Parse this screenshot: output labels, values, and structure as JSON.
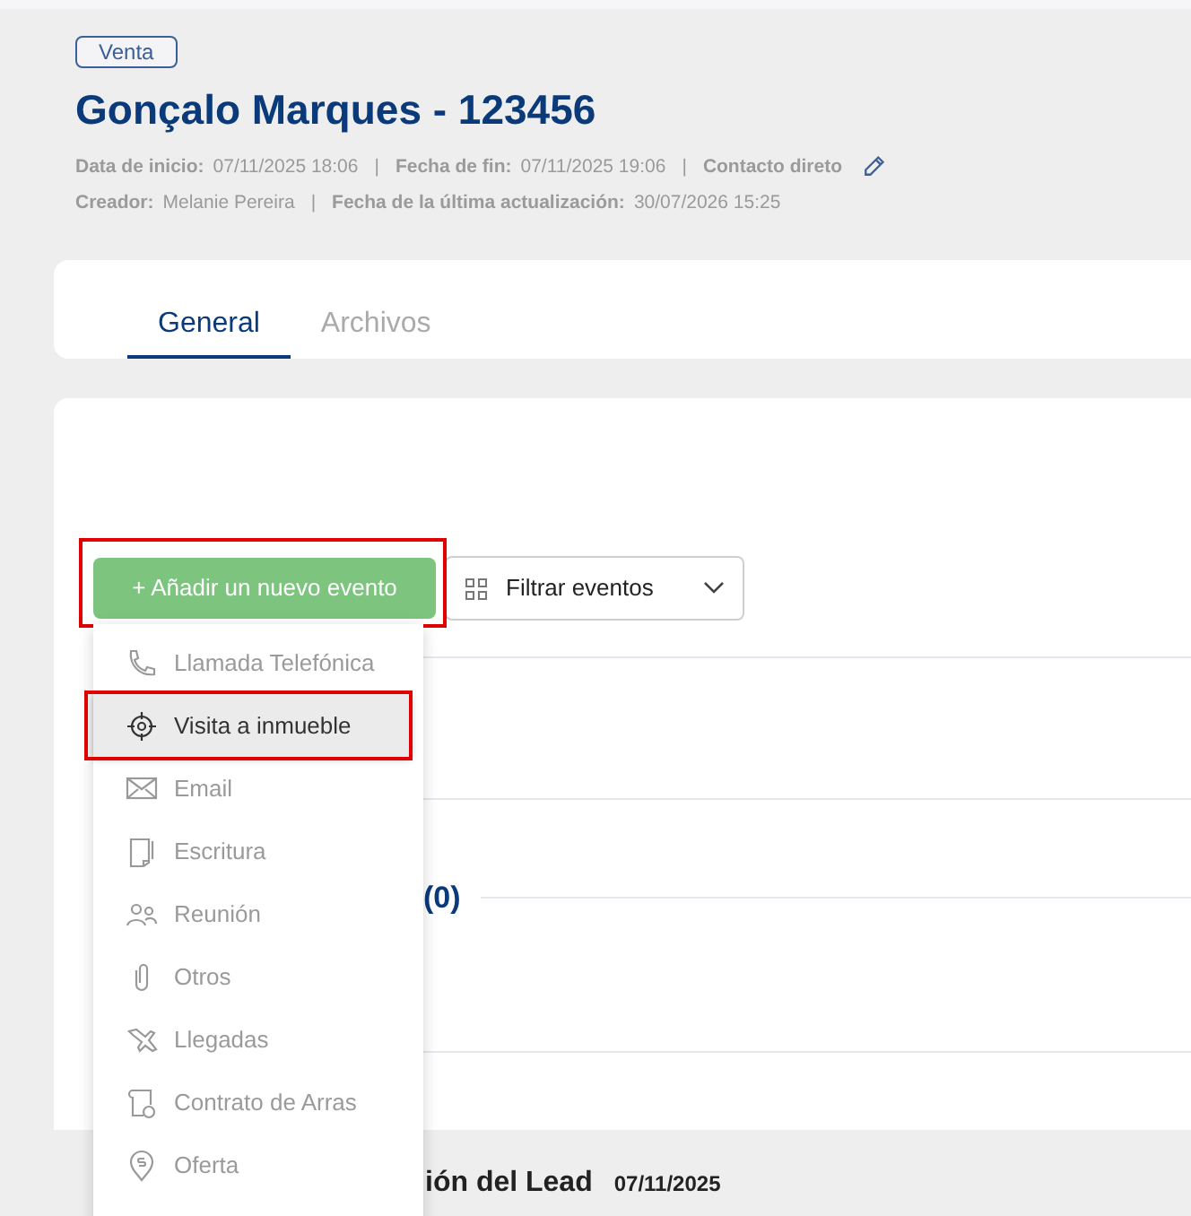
{
  "header": {
    "badge": "Venta",
    "title": "Gonçalo Marques - 123456",
    "meta_line_1": [
      {
        "label": "Data de inicio:",
        "value": "07/11/2025 18:06"
      },
      {
        "label": "Fecha de fin:",
        "value": "07/11/2025 19:06"
      },
      {
        "label": "Contacto direto"
      }
    ],
    "separator": "|",
    "meta_line_2": [
      {
        "label": "Creador:",
        "value": "Melanie Pereira"
      },
      {
        "label": "Fecha de la última actualización:",
        "value": "30/07/2026 15:25"
      }
    ]
  },
  "tabs": [
    {
      "label": "General",
      "selected": true
    },
    {
      "label": "Archivos",
      "selected": false
    }
  ],
  "toolbar": {
    "add_button": "+ Añadir un nuevo evento",
    "filter_button": "Filtrar eventos"
  },
  "section_count": "(0)",
  "lead_row": {
    "heading": "ión del Lead",
    "date": "07/11/2025"
  },
  "menu": [
    {
      "kind": "phone",
      "label": "Llamada Telefónica",
      "selected": false
    },
    {
      "kind": "visit",
      "label": "Visita a inmueble",
      "selected": true
    },
    {
      "kind": "email",
      "label": "Email",
      "selected": false
    },
    {
      "kind": "deed",
      "label": "Escritura",
      "selected": false
    },
    {
      "kind": "meeting",
      "label": "Reunión",
      "selected": false
    },
    {
      "kind": "other",
      "label": "Otros",
      "selected": false
    },
    {
      "kind": "arrival",
      "label": "Llegadas",
      "selected": false
    },
    {
      "kind": "contract",
      "label": "Contrato de Arras",
      "selected": false
    },
    {
      "kind": "offer",
      "label": "Oferta",
      "selected": false
    }
  ]
}
